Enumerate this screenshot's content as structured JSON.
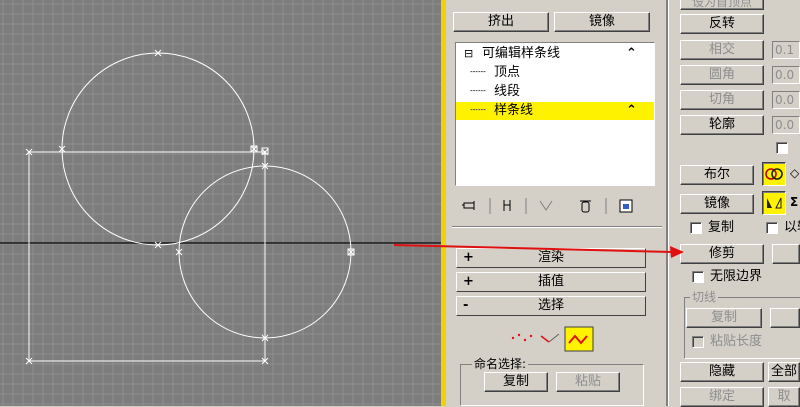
{
  "toolbar": {
    "extrude": "挤出",
    "mirror": "镜像"
  },
  "modifier_stack": {
    "items": [
      {
        "label": "可编辑样条线",
        "level": 0
      },
      {
        "label": "顶点",
        "level": 1
      },
      {
        "label": "线段",
        "level": 1
      },
      {
        "label": "样条线",
        "level": 1,
        "selected": true
      }
    ]
  },
  "rollouts": {
    "render": {
      "sign": "+",
      "title": "渲染"
    },
    "interpolation": {
      "sign": "+",
      "title": "插值"
    },
    "selection": {
      "sign": "-",
      "title": "选择"
    }
  },
  "named_selection": {
    "label": "命名选择:",
    "copy": "复制",
    "paste": "粘贴"
  },
  "right_panel": {
    "set_first_vertex": "设为首顶点",
    "reverse": "反转",
    "intersect": "相交",
    "fillet": "圆角",
    "chamfer": "切角",
    "outline": "轮廓",
    "intersect_value": "0.1",
    "fillet_value": "0.0",
    "chamfer_value": "0.0",
    "outline_value": "0.0",
    "boolean": "布尔",
    "mirror": "镜像",
    "copy_check": "复制",
    "about_pivot_check": "以轴",
    "trim": "修剪",
    "infinite_bounds": "无限边界",
    "tangent_group": "切线",
    "tangent_copy": "复制",
    "paste_length": "粘贴长度",
    "hide": "隐藏",
    "unhide_all": "全部",
    "bind": "绑定",
    "unbind": "取"
  },
  "colors": {
    "viewport_bg": "#7d7d7d",
    "grid": "#8f8f8f",
    "spline": "#ffffff",
    "selection_yellow": "#fff200",
    "arrow_red": "#e01010"
  }
}
